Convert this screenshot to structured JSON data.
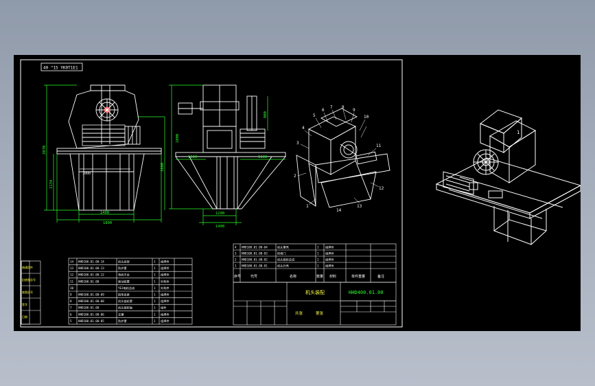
{
  "drawing": {
    "title_block": {
      "assembly_name": "机头装配",
      "drawing_no": "HHD400.01.00",
      "count_label": "共张",
      "sheet_label": "第张"
    },
    "corner_label": "40 \"15 YK0T1E1",
    "dimensions": {
      "front_height": "2870",
      "front_mid": "1134",
      "front_lower": "1000",
      "front_base_a": "1400",
      "front_base_b": "1800",
      "front_top": "1000",
      "side_top": "800",
      "side_right": "1100",
      "side_left": "1000",
      "side_width": "1020",
      "side_base_a": "1200",
      "side_base_b": "1400"
    },
    "balloons": [
      "5",
      "6",
      "7",
      "8",
      "9",
      "10",
      "4",
      "3",
      "2",
      "1",
      "11",
      "12",
      "13",
      "14"
    ],
    "parts_upper": [
      {
        "no": "4",
        "code": "HHD100.01.00-04",
        "name": "机头罩壳",
        "qty": "1",
        "mat": "组焊件"
      },
      {
        "no": "3",
        "code": "HHD100.01.00-03",
        "name": "检修门",
        "qty": "1",
        "mat": "组焊件"
      },
      {
        "no": "2",
        "code": "HHD100.01.00-02",
        "name": "机头链轮总成",
        "qty": "1",
        "mat": "组焊件"
      },
      {
        "no": "1",
        "code": "HHD100.01.00-01",
        "name": "机头外壳",
        "qty": "1",
        "mat": "组焊件"
      }
    ],
    "parts_header": [
      "序号",
      "代号",
      "名称",
      "数量",
      "材料",
      "单件重量",
      "备注"
    ],
    "parts_lower": [
      {
        "no": "14",
        "code": "HHD100.01.00-14",
        "name": "机头底架",
        "qty": "1",
        "mat": "组焊件"
      },
      {
        "no": "13",
        "code": "HHD100.01.00-13",
        "name": "防护罩",
        "qty": "1",
        "mat": "组焊件"
      },
      {
        "no": "12",
        "code": "HHD100.01.00-12",
        "name": "电机平台",
        "qty": "1",
        "mat": "组焊件"
      },
      {
        "no": "11",
        "code": "HHD100.01.00",
        "name": "驱动装置",
        "qty": "1",
        "mat": "外购件"
      },
      {
        "no": "10",
        "code": "",
        "name": "YE3电机总成",
        "qty": "1",
        "mat": "外购件"
      },
      {
        "no": "9",
        "code": "HHD100.01.00-09",
        "name": "链条张紧",
        "qty": "1",
        "mat": "组焊件"
      },
      {
        "no": "8",
        "code": "HHD100.01.00-08",
        "name": "机头链轮罩",
        "qty": "1",
        "mat": "组焊件"
      },
      {
        "no": "7",
        "code": "HHD100.01.00",
        "name": "机头链轮轴",
        "qty": "1",
        "mat": "组件"
      },
      {
        "no": "6",
        "code": "HHD100.01.00-06",
        "name": "支撑",
        "qty": "1",
        "mat": "组焊件"
      },
      {
        "no": "5",
        "code": "HHD100.01.00-05",
        "name": "防护罩",
        "qty": "1",
        "mat": "组焊件"
      }
    ],
    "left_block": [
      "借通用件",
      "旧底图总号",
      "底图总号",
      "签字",
      "日期"
    ]
  }
}
